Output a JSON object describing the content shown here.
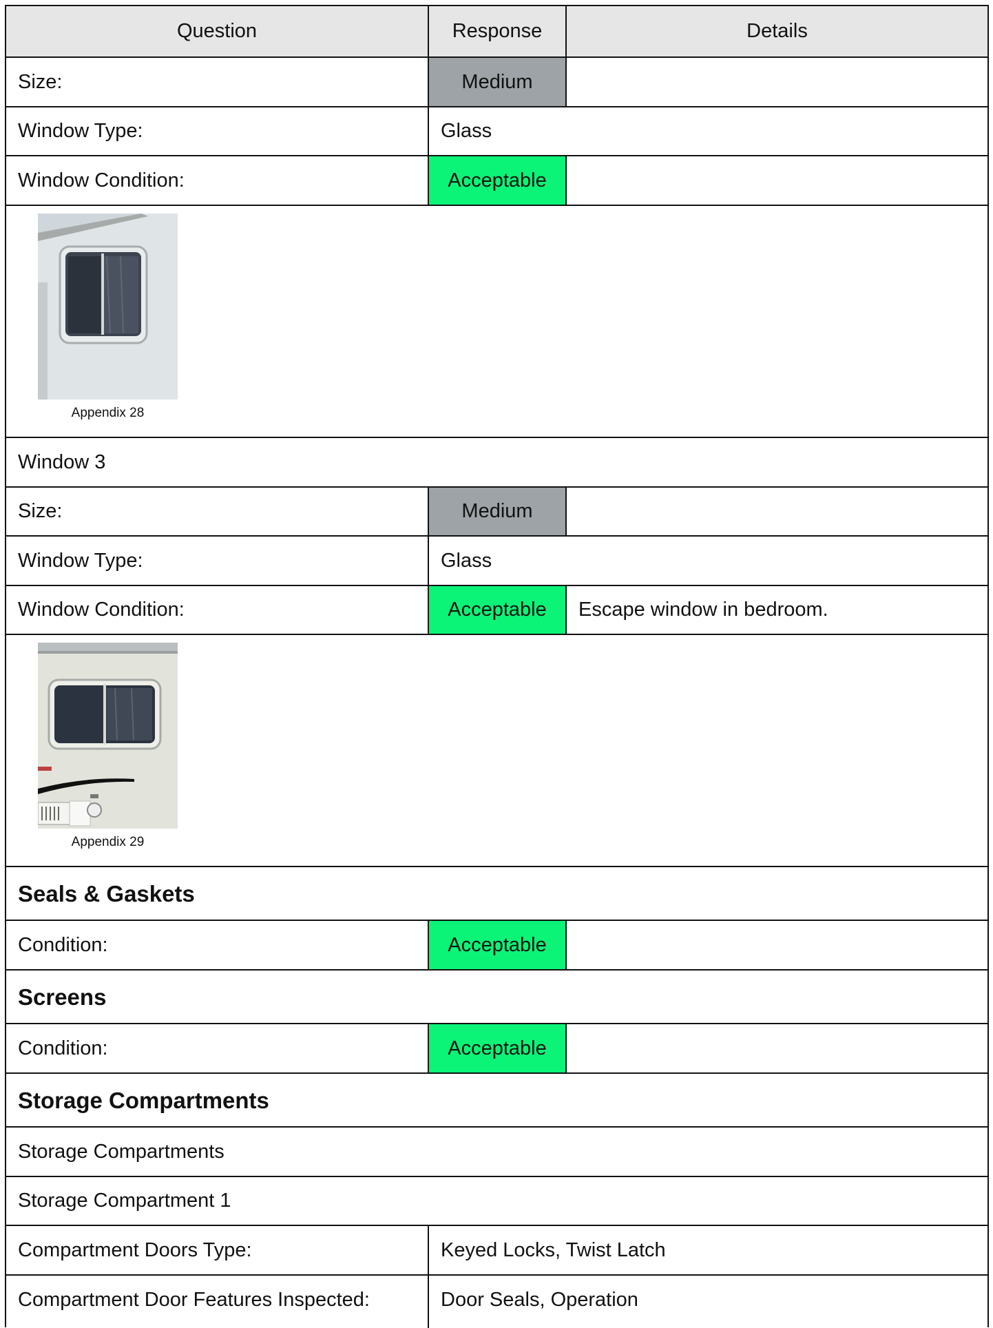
{
  "header": {
    "question": "Question",
    "response": "Response",
    "details": "Details"
  },
  "rows": {
    "size1": {
      "question": "Size:",
      "response": "Medium"
    },
    "type1": {
      "question": "Window Type:",
      "response": "Glass"
    },
    "cond1": {
      "question": "Window Condition:",
      "response": "Acceptable"
    },
    "photo1": {
      "caption": "Appendix 28"
    },
    "window3": {
      "label": "Window 3"
    },
    "size2": {
      "question": "Size:",
      "response": "Medium"
    },
    "type2": {
      "question": "Window Type:",
      "response": "Glass"
    },
    "cond2": {
      "question": "Window Condition:",
      "response": "Acceptable",
      "details": "Escape window in bedroom."
    },
    "photo2": {
      "caption": "Appendix 29"
    },
    "seals": {
      "heading": "Seals & Gaskets",
      "question": "Condition:",
      "response": "Acceptable"
    },
    "screens": {
      "heading": "Screens",
      "question": "Condition:",
      "response": "Acceptable"
    },
    "storage": {
      "heading": "Storage Compartments",
      "subheading": "Storage Compartments",
      "item": "Storage Compartment 1",
      "doors_question": "Compartment Doors Type:",
      "doors_response": "Keyed Locks, Twist Latch",
      "features_question": "Compartment Door Features Inspected:",
      "features_response": "Door Seals, Operation"
    }
  },
  "colors": {
    "grey": "#9da3a6",
    "green": "#0bf477",
    "header_bg": "#e6e6e6"
  }
}
